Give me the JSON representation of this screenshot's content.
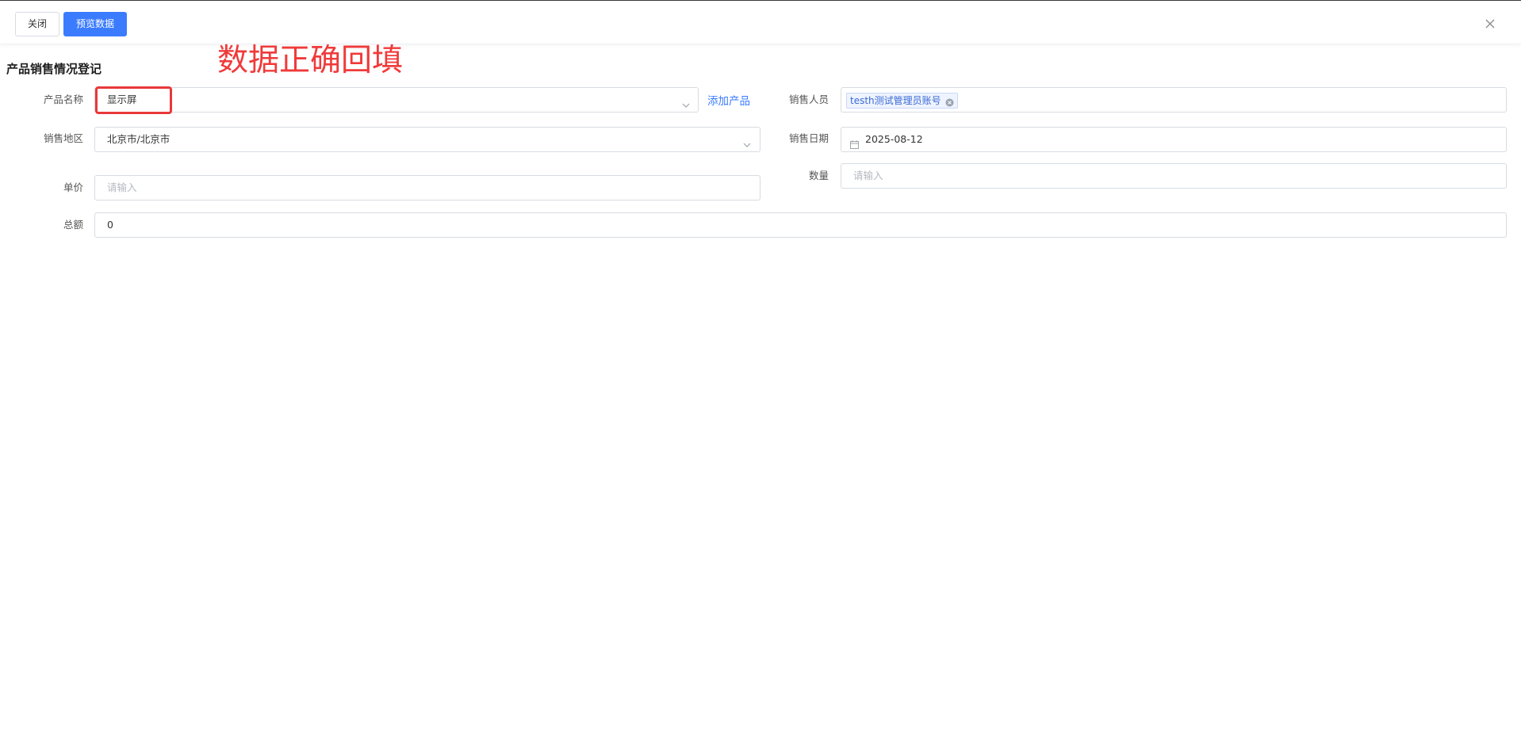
{
  "toolbar": {
    "close_label": "关闭",
    "preview_label": "预览数据"
  },
  "annotation": {
    "text": "数据正确回填",
    "color": "#e8383b"
  },
  "form": {
    "title": "产品销售情况登记",
    "product_name": {
      "label": "产品名称",
      "value": "显示屏",
      "add_link": "添加产品"
    },
    "salesperson": {
      "label": "销售人员",
      "tag": "testh测试管理员账号"
    },
    "region": {
      "label": "销售地区",
      "value": "北京市/北京市"
    },
    "sale_date": {
      "label": "销售日期",
      "value": "2025-08-12"
    },
    "unit_price": {
      "label": "单价",
      "placeholder": "请输入"
    },
    "quantity": {
      "label": "数量",
      "placeholder": "请输入"
    },
    "total": {
      "label": "总额",
      "value": "0"
    }
  },
  "colors": {
    "primary": "#3b7cff",
    "annotation_red": "#f03a3a"
  },
  "icons": [
    "close-icon",
    "chevron-down-icon",
    "tag-remove-icon",
    "calendar-icon"
  ]
}
